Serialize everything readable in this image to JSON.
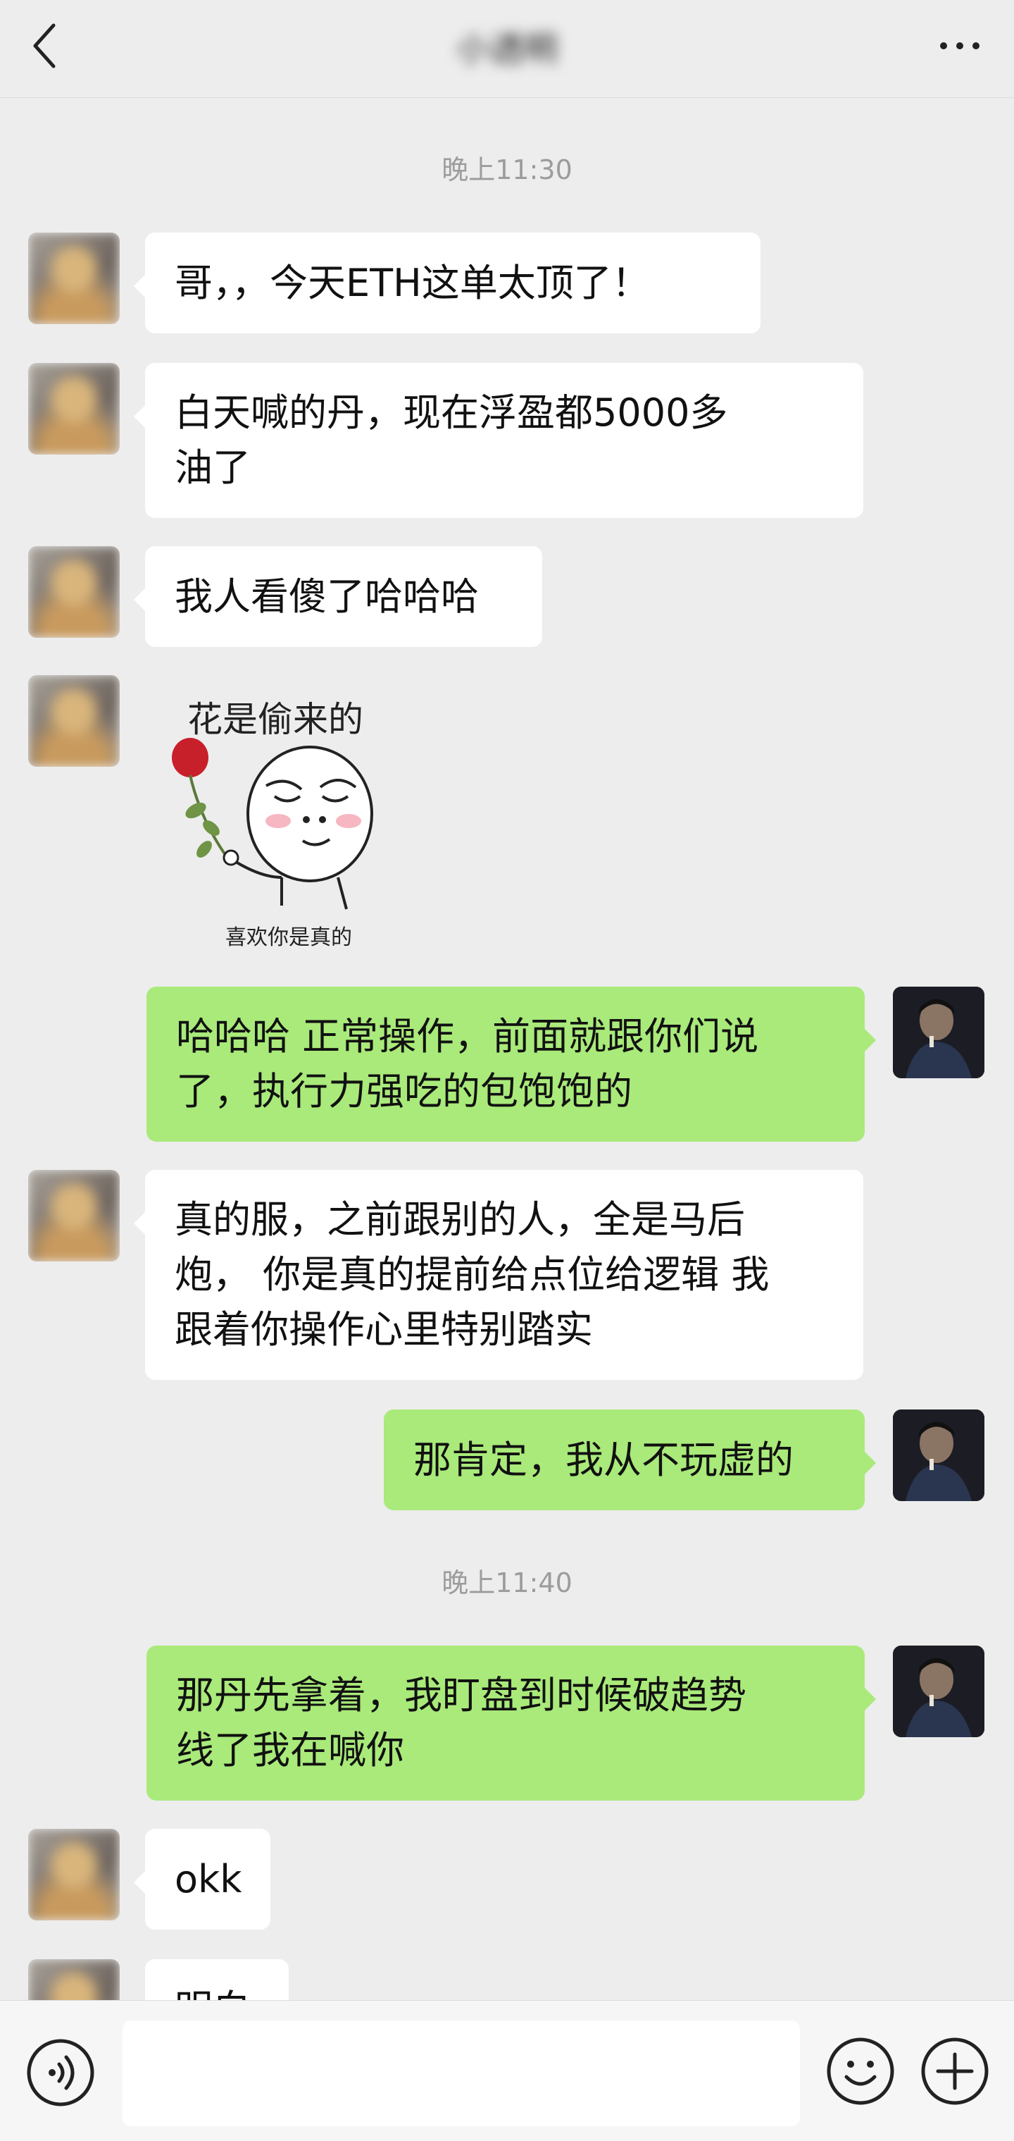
{
  "header": {
    "title": "小透明"
  },
  "messages": {
    "time1": "晚上11:30",
    "m1": "哥，，今天ETH这单太顶了！",
    "m2_line1": "白天喊的丹，现在浮盈都5000多",
    "m2_line2": "油了",
    "m3": "我人看傻了哈哈哈",
    "sticker_top": "花是偷来的",
    "sticker_bottom": "喜欢你是真的",
    "m4_line1": "哈哈哈 正常操作，前面就跟你们说",
    "m4_line2": "了，执行力强吃的包饱饱的",
    "m5_line1": "真的服，之前跟别的人，全是马后",
    "m5_line2": "炮， 你是真的提前给点位给逻辑 我",
    "m5_line3": "跟着你操作心里特别踏实",
    "m6": "那肯定，我从不玩虚的",
    "time2": "晚上11:40",
    "m7_line1": "那丹先拿着，我盯盘到时候破趋势",
    "m7_line2": "线了我在喊你",
    "m8": "okk",
    "m9": "明白"
  },
  "colors": {
    "background": "#ededed",
    "incoming_bubble": "#ffffff",
    "outgoing_bubble": "#a9ea7a",
    "timestamp": "#9c9c9c"
  },
  "icons": [
    "back-arrow-icon",
    "more-dots-icon",
    "voice-icon",
    "emoji-icon",
    "plus-icon"
  ]
}
